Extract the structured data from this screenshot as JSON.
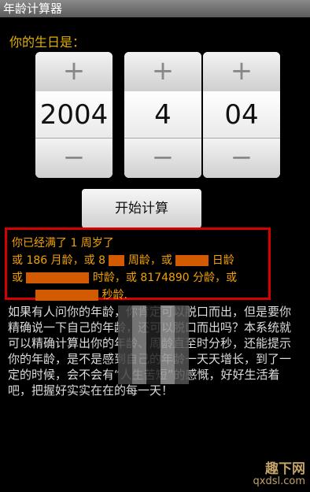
{
  "window": {
    "title": "年龄计算器"
  },
  "form": {
    "prompt": "你的生日是："
  },
  "pickers": [
    {
      "plus": "+",
      "value": "2004",
      "minus": "−"
    },
    {
      "plus": "+",
      "value": "4",
      "minus": "−"
    },
    {
      "plus": "+",
      "value": "04",
      "minus": "−"
    }
  ],
  "actions": {
    "calculate_label": "开始计算"
  },
  "result": {
    "line1": "你已经满了 1 周岁了",
    "line2a": "或 186 月龄，或 8",
    "line2b": "周龄，或",
    "line2c": "日龄",
    "line3a": "或",
    "line3b": "时龄，或 8174890 分龄，或",
    "line4": "秒龄."
  },
  "description": "如果有人问你的年龄，你肯定可以脱口而出，但是要你精确说一下自己的年龄，还可以脱口而出吗？本系统就可以精确计算出你的年龄、周龄直至时分秒，还能提示你的年龄，是不是感到自己的年龄一天天增长，到了一定的时候，会不会有“人生苦短”的感慨，好好生活着吧，把握好实实在在的每一天！",
  "watermark": {
    "text": "趣下网",
    "url": "qxdsl.com"
  }
}
